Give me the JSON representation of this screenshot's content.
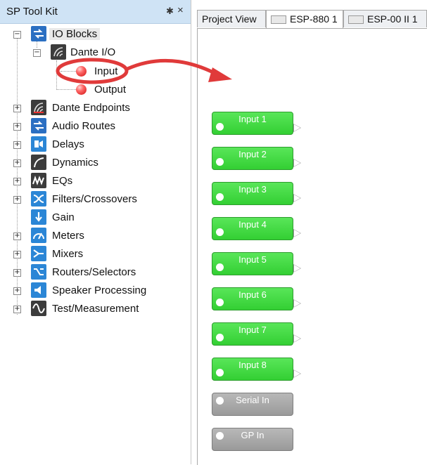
{
  "toolkit": {
    "title": "SP Tool Kit",
    "pin_icon": "✱",
    "close_icon": "×",
    "io_blocks": "IO Blocks",
    "dante_io": "Dante I/O",
    "input": "Input",
    "output": "Output",
    "categories": [
      {
        "label": "Dante Endpoints",
        "icon": "dante-endpoints-icon"
      },
      {
        "label": "Audio Routes",
        "icon": "audio-routes-icon"
      },
      {
        "label": "Delays",
        "icon": "delays-icon"
      },
      {
        "label": "Dynamics",
        "icon": "dynamics-icon"
      },
      {
        "label": "EQs",
        "icon": "eqs-icon"
      },
      {
        "label": "Filters/Crossovers",
        "icon": "filters-crossovers-icon"
      },
      {
        "label": "Gain",
        "icon": "gain-icon"
      },
      {
        "label": "Meters",
        "icon": "meters-icon"
      },
      {
        "label": "Mixers",
        "icon": "mixers-icon"
      },
      {
        "label": "Routers/Selectors",
        "icon": "routers-selectors-icon"
      },
      {
        "label": "Speaker Processing",
        "icon": "speaker-processing-icon"
      },
      {
        "label": "Test/Measurement",
        "icon": "test-measurement-icon"
      }
    ]
  },
  "tabs": [
    {
      "label": "Project View"
    },
    {
      "label": "ESP-880 1"
    },
    {
      "label": "ESP-00 II 1"
    }
  ],
  "canvas": {
    "blocks": [
      {
        "label": "Input 1",
        "kind": "green"
      },
      {
        "label": "Input 2",
        "kind": "green"
      },
      {
        "label": "Input 3",
        "kind": "green"
      },
      {
        "label": "Input 4",
        "kind": "green"
      },
      {
        "label": "Input 5",
        "kind": "green"
      },
      {
        "label": "Input 6",
        "kind": "green"
      },
      {
        "label": "Input 7",
        "kind": "green"
      },
      {
        "label": "Input 8",
        "kind": "green"
      },
      {
        "label": "Serial In",
        "kind": "gray"
      },
      {
        "label": "GP In",
        "kind": "gray"
      }
    ]
  },
  "colors": {
    "header_bg": "#cfe3f5",
    "block_green": "#3fd83f",
    "block_gray": "#a6a6a6",
    "annotation_red": "#e03a3a"
  }
}
